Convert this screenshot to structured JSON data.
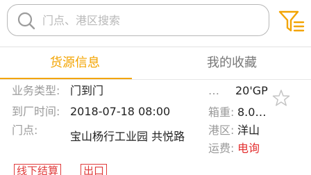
{
  "search": {
    "placeholder": "门点、港区搜索"
  },
  "tabs": [
    {
      "label": "货源信息",
      "active": true
    },
    {
      "label": "我的收藏",
      "active": false
    }
  ],
  "colors": {
    "accent": "#f3a400",
    "price": "#e33030",
    "tag": "#e03a3a",
    "label": "#9a9a9a"
  },
  "cargo": {
    "business_type_label": "业务类型:",
    "business_type_value": "门到门",
    "arrival_time_label": "到厂时间:",
    "arrival_time_value": "2018-07-18 08:00",
    "location_label": "门点:",
    "location_value": "宝山杨行工业园 共悦路",
    "container_label": "…",
    "container_value": "20'GP",
    "weight_label": "箱重:",
    "weight_value": "8.0…",
    "port_label": "港区:",
    "port_value": "洋山",
    "fee_label": "运费:",
    "fee_value": "电询",
    "tags": [
      "线下结算",
      "出口"
    ],
    "favorite_icon": "star-outline-icon"
  }
}
